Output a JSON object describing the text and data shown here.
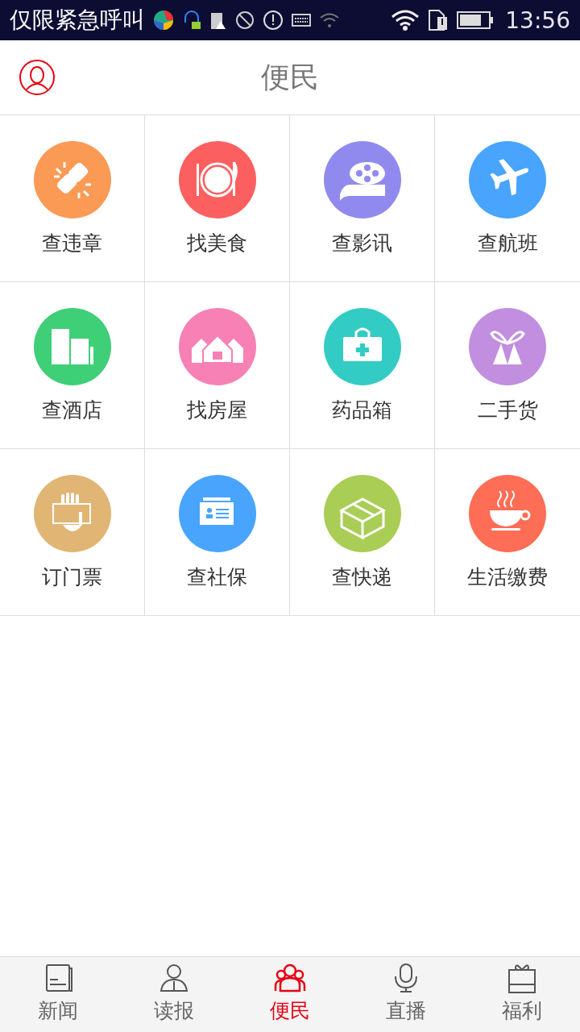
{
  "status_bar": {
    "carrier": "仅限紧急呼叫",
    "time": "13:56"
  },
  "header": {
    "title": "便民"
  },
  "services": [
    {
      "label": "查违章",
      "color": "#fa9a55"
    },
    {
      "label": "找美食",
      "color": "#fc5f5f"
    },
    {
      "label": "查影讯",
      "color": "#918aee"
    },
    {
      "label": "查航班",
      "color": "#48a4fc"
    },
    {
      "label": "查酒店",
      "color": "#3ecf77"
    },
    {
      "label": "找房屋",
      "color": "#f780b4"
    },
    {
      "label": "药品箱",
      "color": "#33ccc4"
    },
    {
      "label": "二手货",
      "color": "#c28ee0"
    },
    {
      "label": "订门票",
      "color": "#e1b574"
    },
    {
      "label": "查社保",
      "color": "#48a4fc"
    },
    {
      "label": "查快递",
      "color": "#a9cd55"
    },
    {
      "label": "生活缴费",
      "color": "#fe6d55"
    }
  ],
  "tabs": [
    {
      "label": "新闻",
      "selected": false
    },
    {
      "label": "读报",
      "selected": false
    },
    {
      "label": "便民",
      "selected": true
    },
    {
      "label": "直播",
      "selected": false
    },
    {
      "label": "福利",
      "selected": false
    }
  ]
}
